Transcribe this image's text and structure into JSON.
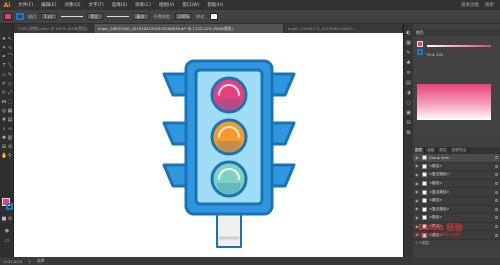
{
  "app": {
    "logo": "Ai"
  },
  "menu": [
    "文件(F)",
    "编辑(E)",
    "对象(O)",
    "文字(T)",
    "选择(S)",
    "效果(C)",
    "视图(V)",
    "窗口(W)",
    "帮助(H)"
  ],
  "menu_right": [
    "基本功能",
    "搜索"
  ],
  "control": {
    "stroke_label": "描边:",
    "stroke_value": "1 pt",
    "uniform": "等比",
    "brush": "基本",
    "opacity_label": "不透明度:",
    "opacity_value": "100%",
    "style_label": "样式:"
  },
  "tabs": [
    {
      "label": "1764 [转换].eps* @ 100% (RGB/预览)",
      "active": false
    },
    {
      "label": "hnpic_18631540_20191021092332098876.ai* @ 1132.52% (RGB/预览)",
      "active": true
    },
    {
      "label": "hnpic_13000174_2019060216402...",
      "active": false
    }
  ],
  "colors": {
    "accent": "#e8417a",
    "stroke": "#1a7ac6",
    "canvas": "#ffffff"
  },
  "color_panel": {
    "title": "颜色",
    "value": "Pink 400"
  },
  "layers": {
    "tabs": [
      "图层",
      "画板",
      "属性",
      "资源导出"
    ],
    "rows": [
      {
        "label": "Group Item",
        "selected": true
      },
      {
        "label": "<路径>",
        "selected": false
      },
      {
        "label": "<复合路径>",
        "selected": false
      },
      {
        "label": "<路径>",
        "selected": false
      },
      {
        "label": "<复合路径>",
        "selected": false
      },
      {
        "label": "<路径>",
        "selected": false
      },
      {
        "label": "<复合路径>",
        "selected": false
      },
      {
        "label": "<路径>",
        "selected": false
      },
      {
        "label": "<路径>",
        "selected": false
      },
      {
        "label": "<路径>",
        "selected": false
      }
    ],
    "footer": "1 个图层"
  },
  "status": {
    "zoom": "1132.52%",
    "page": "1",
    "tool": "选择"
  },
  "watermark": {
    "brand": "Baidu 经验",
    "url": "jingyan.baidu.com"
  },
  "traffic_light": {
    "lights": [
      "red",
      "yellow",
      "green"
    ],
    "colors": {
      "outline": "#1b72b5",
      "body": "#2f96e0",
      "panel": "#9fdcf5",
      "red": "#e83e7e",
      "yellow": "#f79a2c",
      "green": "#7fd1c1",
      "pole": "#f0f0f0"
    }
  }
}
